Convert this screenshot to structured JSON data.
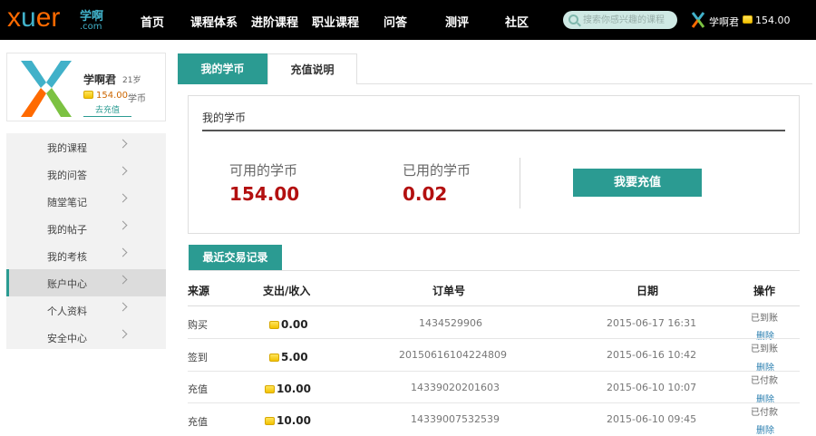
{
  "header": {
    "logo_text": "xuer",
    "logo_cn": "学啊",
    "logo_com": ".com",
    "nav": [
      "首页",
      "课程体系",
      "进阶课程",
      "职业课程",
      "问答",
      "测评",
      "社区"
    ],
    "search_placeholder": "搜索你感兴趣的课程",
    "user_name": "学啊君",
    "balance": "154.00"
  },
  "profile": {
    "name": "学啊君",
    "age": "21岁",
    "balance": "154.00",
    "unit": "学币",
    "recharge_link": "去充值"
  },
  "sidebar": {
    "items": [
      {
        "label": "我的课程"
      },
      {
        "label": "我的问答"
      },
      {
        "label": "随堂笔记"
      },
      {
        "label": "我的帖子"
      },
      {
        "label": "我的考核"
      },
      {
        "label": "账户中心"
      },
      {
        "label": "个人资料"
      },
      {
        "label": "安全中心"
      }
    ],
    "active_index": 5
  },
  "tabs": [
    "我的学币",
    "充值说明"
  ],
  "panel": {
    "title": "我的学币",
    "available_label": "可用的学币",
    "available_value": "154.00",
    "used_label": "已用的学币",
    "used_value": "0.02",
    "recharge_button": "我要充值"
  },
  "transactions": {
    "tab_label": "最近交易记录",
    "headers": {
      "source": "来源",
      "amount": "支出/收入",
      "order": "订单号",
      "date": "日期",
      "action": "操作"
    },
    "rows": [
      {
        "source": "购买",
        "amount": "0.00",
        "order": "1434529906",
        "date": "2015-06-17 16:31",
        "status": "已到账",
        "delete": "删除"
      },
      {
        "source": "签到",
        "amount": "5.00",
        "order": "20150616104224809",
        "date": "2015-06-16 10:42",
        "status": "已到账",
        "delete": "删除"
      },
      {
        "source": "充值",
        "amount": "10.00",
        "order": "14339020201603",
        "date": "2015-06-10 10:07",
        "status": "已付款",
        "delete": "删除"
      },
      {
        "source": "充值",
        "amount": "10.00",
        "order": "14339007532539",
        "date": "2015-06-10 09:45",
        "status": "已付款",
        "delete": "删除"
      }
    ]
  },
  "colors": {
    "accent": "#2b9b92",
    "value_red": "#b31010",
    "orange": "#ff6a00"
  },
  "icons": [
    "search-icon",
    "coin-icon",
    "chevron-right-icon",
    "xuer-avatar-icon"
  ]
}
